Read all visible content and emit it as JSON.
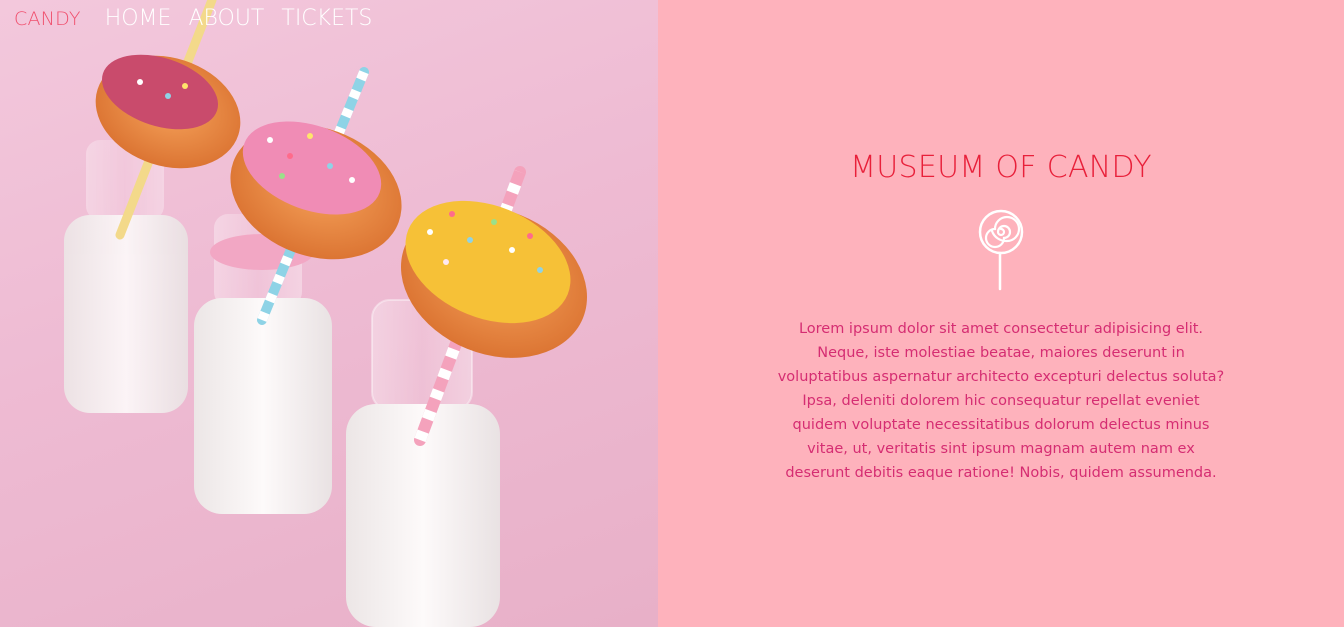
{
  "nav": {
    "brand": "CANDY",
    "links": [
      {
        "label": "HOME"
      },
      {
        "label": "ABOUT"
      },
      {
        "label": "TICKETS"
      }
    ]
  },
  "hero": {
    "colors": {
      "background": "#eebbd3",
      "milk": "#fbf6f4",
      "frosting_yellow": "#f6c137"
    }
  },
  "main": {
    "title": "MUSEUM OF CANDY",
    "icon": "lollipop-icon",
    "body": "Lorem ipsum dolor sit amet consectetur adipisicing elit. Neque, iste molestiae beatae, maiores deserunt in voluptatibus aspernatur architecto excepturi delectus soluta? Ipsa, deleniti dolorem hic consequatur repellat eveniet quidem voluptate necessitatibus dolorum delectus minus vitae, ut, veritatis sint ipsum magnam autem nam ex deserunt debitis eaque ratione! Nobis, quidem assumenda."
  },
  "colors": {
    "panel_background": "#feb2bc",
    "title": "#e8203a",
    "body_text": "#d52d72",
    "brand": "#f0506e"
  }
}
